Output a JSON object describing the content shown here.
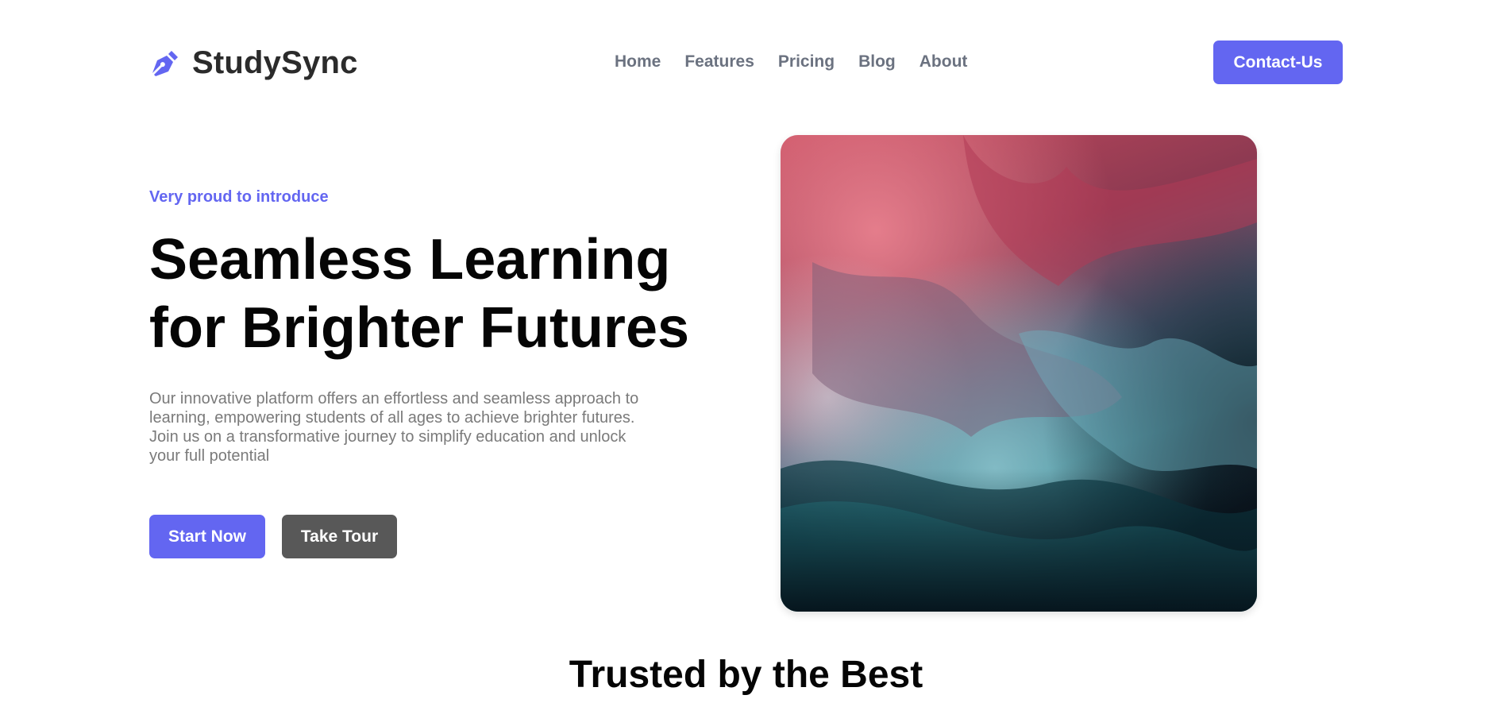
{
  "brand": {
    "name": "StudySync",
    "icon": "pen-nib-icon"
  },
  "nav": {
    "items": [
      {
        "label": "Home"
      },
      {
        "label": "Features"
      },
      {
        "label": "Pricing"
      },
      {
        "label": "Blog"
      },
      {
        "label": "About"
      }
    ]
  },
  "header": {
    "contact_label": "Contact-Us"
  },
  "hero": {
    "eyebrow": "Very proud to introduce",
    "headline_line1": "Seamless Learning",
    "headline_line2": "for Brighter Futures",
    "description": "Our innovative platform offers an effortless and seamless approach to learning, empowering students of all ages to achieve brighter futures. Join us on a transformative journey to simplify education and unlock your full potential",
    "primary_cta": "Start Now",
    "secondary_cta": "Take Tour"
  },
  "trusted": {
    "title": "Trusted by the Best"
  },
  "colors": {
    "accent": "#6366f1",
    "secondary_button": "#585858",
    "nav_text": "#6b7280",
    "body_text": "#7a7a7a"
  }
}
